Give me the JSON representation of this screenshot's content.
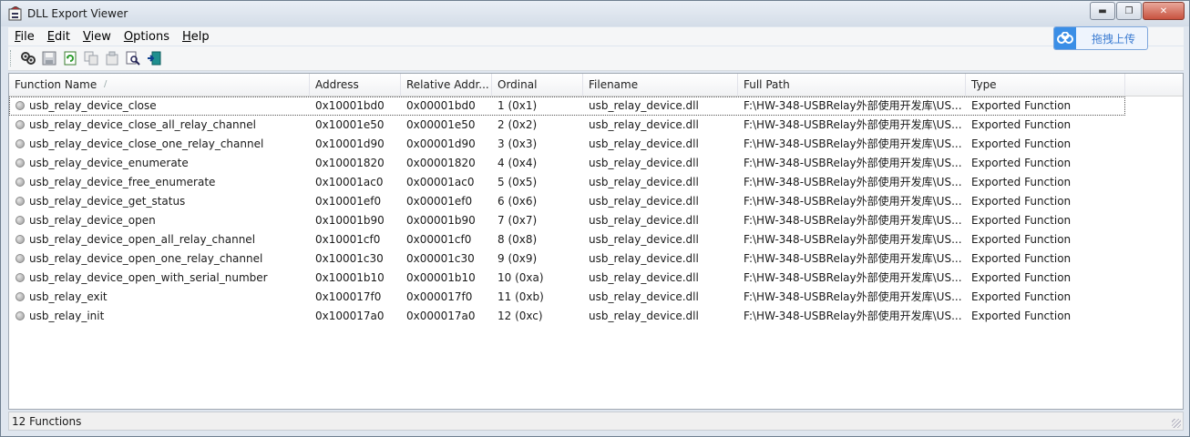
{
  "window": {
    "title": "DLL Export Viewer",
    "min_symbol": "▬",
    "max_symbol": "❐",
    "close_symbol": "✕"
  },
  "menu": [
    "File",
    "Edit",
    "View",
    "Options",
    "Help"
  ],
  "toolbar": {
    "icons": [
      "find-dll-icon",
      "save-icon",
      "refresh-icon",
      "copy-icon",
      "properties-icon",
      "search-icon",
      "exit-icon"
    ]
  },
  "badge": {
    "label": "拖拽上传"
  },
  "columns": [
    "Function Name",
    "Address",
    "Relative Addr...",
    "Ordinal",
    "Filename",
    "Full Path",
    "Type"
  ],
  "rows": [
    [
      "usb_relay_device_close",
      "0x10001bd0",
      "0x00001bd0",
      "1 (0x1)",
      "usb_relay_device.dll",
      "F:\\HW-348-USBRelay外部使用开发库\\US...",
      "Exported Function"
    ],
    [
      "usb_relay_device_close_all_relay_channel",
      "0x10001e50",
      "0x00001e50",
      "2 (0x2)",
      "usb_relay_device.dll",
      "F:\\HW-348-USBRelay外部使用开发库\\US...",
      "Exported Function"
    ],
    [
      "usb_relay_device_close_one_relay_channel",
      "0x10001d90",
      "0x00001d90",
      "3 (0x3)",
      "usb_relay_device.dll",
      "F:\\HW-348-USBRelay外部使用开发库\\US...",
      "Exported Function"
    ],
    [
      "usb_relay_device_enumerate",
      "0x10001820",
      "0x00001820",
      "4 (0x4)",
      "usb_relay_device.dll",
      "F:\\HW-348-USBRelay外部使用开发库\\US...",
      "Exported Function"
    ],
    [
      "usb_relay_device_free_enumerate",
      "0x10001ac0",
      "0x00001ac0",
      "5 (0x5)",
      "usb_relay_device.dll",
      "F:\\HW-348-USBRelay外部使用开发库\\US...",
      "Exported Function"
    ],
    [
      "usb_relay_device_get_status",
      "0x10001ef0",
      "0x00001ef0",
      "6 (0x6)",
      "usb_relay_device.dll",
      "F:\\HW-348-USBRelay外部使用开发库\\US...",
      "Exported Function"
    ],
    [
      "usb_relay_device_open",
      "0x10001b90",
      "0x00001b90",
      "7 (0x7)",
      "usb_relay_device.dll",
      "F:\\HW-348-USBRelay外部使用开发库\\US...",
      "Exported Function"
    ],
    [
      "usb_relay_device_open_all_relay_channel",
      "0x10001cf0",
      "0x00001cf0",
      "8 (0x8)",
      "usb_relay_device.dll",
      "F:\\HW-348-USBRelay外部使用开发库\\US...",
      "Exported Function"
    ],
    [
      "usb_relay_device_open_one_relay_channel",
      "0x10001c30",
      "0x00001c30",
      "9 (0x9)",
      "usb_relay_device.dll",
      "F:\\HW-348-USBRelay外部使用开发库\\US...",
      "Exported Function"
    ],
    [
      "usb_relay_device_open_with_serial_number",
      "0x10001b10",
      "0x00001b10",
      "10 (0xa)",
      "usb_relay_device.dll",
      "F:\\HW-348-USBRelay外部使用开发库\\US...",
      "Exported Function"
    ],
    [
      "usb_relay_exit",
      "0x100017f0",
      "0x000017f0",
      "11 (0xb)",
      "usb_relay_device.dll",
      "F:\\HW-348-USBRelay外部使用开发库\\US...",
      "Exported Function"
    ],
    [
      "usb_relay_init",
      "0x100017a0",
      "0x000017a0",
      "12 (0xc)",
      "usb_relay_device.dll",
      "F:\\HW-348-USBRelay外部使用开发库\\US...",
      "Exported Function"
    ]
  ],
  "status": {
    "text": "12 Functions"
  },
  "colors": {
    "badge_accent": "#3a8ee6",
    "title_bar": "#d4dde8",
    "close_button": "#c8523f"
  }
}
